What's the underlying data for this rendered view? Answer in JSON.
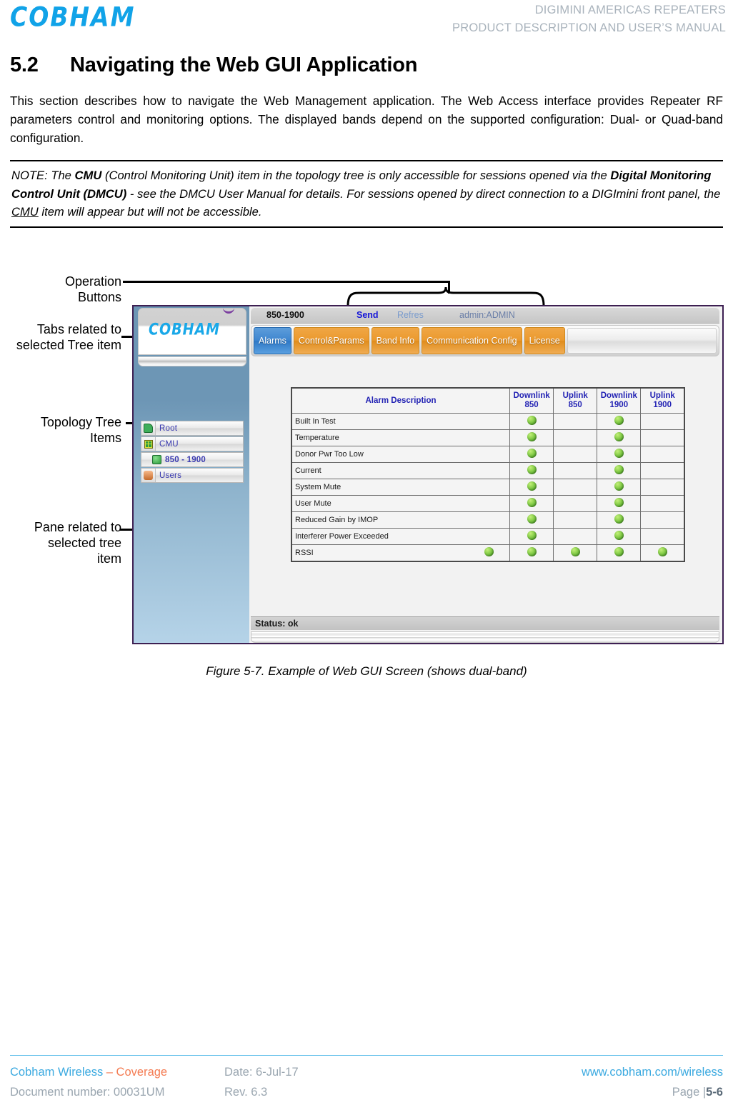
{
  "header": {
    "logo": "COBHAM",
    "line1": "DIGIMINI AMERICAS REPEATERS",
    "line2": "PRODUCT DESCRIPTION AND USER’S MANUAL"
  },
  "section": {
    "number": "5.2",
    "title": "Navigating the Web GUI Application",
    "paragraph": "This section describes how to navigate the Web Management application. The Web Access interface provides Repeater RF parameters control and monitoring options. The displayed bands depend on the supported configuration: Dual- or Quad-band configuration."
  },
  "note": {
    "p1_a": "NOTE: The ",
    "p1_b": "CMU",
    "p1_c": " (Control Monitoring Unit) item in the topology tree is only accessible for sessions opened via the ",
    "p1_d": "Digital Monitoring Control Unit (DMCU)",
    "p1_e": " - see the DMCU User Manual for details. For sessions opened by direct connection to a DIGImini front panel, the ",
    "p1_f": "CMU",
    "p1_g": " item will appear but will not be accessible."
  },
  "callouts": {
    "operation_buttons": "Operation\nButtons",
    "tabs": "Tabs related to\nselected Tree item",
    "topology": "Topology Tree\nItems",
    "pane": "Pane related to\nselected tree\nitem"
  },
  "gui": {
    "logo": "COBHAM",
    "topbar": {
      "band": "850-1900",
      "send": "Send",
      "refresh": "Refres",
      "user": "admin:ADMIN"
    },
    "tabs": [
      {
        "label": "Alarms",
        "active": true
      },
      {
        "label": "Control&Params",
        "active": false
      },
      {
        "label": "Band Info",
        "active": false
      },
      {
        "label": "Communication Config",
        "active": false
      },
      {
        "label": "License",
        "active": false
      }
    ],
    "tree": [
      {
        "label": "Root",
        "icon": "root-node-icon",
        "level": 0
      },
      {
        "label": "CMU",
        "icon": "cmu-node-icon",
        "level": 1
      },
      {
        "label": "850 - 1900",
        "icon": "band-node-icon",
        "level": 2
      },
      {
        "label": "Users",
        "icon": "users-node-icon",
        "level": 0
      }
    ],
    "alarm_table": {
      "columns": [
        "Alarm Description",
        "Downlink 850",
        "Uplink 850",
        "Downlink 1900",
        "Uplink 1900"
      ],
      "column_lines": [
        [
          "Alarm Description",
          ""
        ],
        [
          "Downlink",
          "850"
        ],
        [
          "Uplink",
          "850"
        ],
        [
          "Downlink",
          "1900"
        ],
        [
          "Uplink",
          "1900"
        ]
      ],
      "rows": [
        {
          "name": "Built In Test",
          "leds": [
            false,
            true,
            false,
            true,
            false
          ]
        },
        {
          "name": "Temperature",
          "leds": [
            false,
            true,
            false,
            true,
            false
          ]
        },
        {
          "name": "Donor Pwr Too Low",
          "leds": [
            false,
            true,
            false,
            true,
            false
          ]
        },
        {
          "name": "Current",
          "leds": [
            false,
            true,
            false,
            true,
            false
          ]
        },
        {
          "name": "System Mute",
          "leds": [
            false,
            true,
            false,
            true,
            false
          ]
        },
        {
          "name": "User Mute",
          "leds": [
            false,
            true,
            false,
            true,
            false
          ]
        },
        {
          "name": "Reduced Gain by IMOP",
          "leds": [
            false,
            true,
            false,
            true,
            false
          ]
        },
        {
          "name": "Interferer Power Exceeded",
          "leds": [
            false,
            true,
            false,
            true,
            false
          ]
        },
        {
          "name": "RSSI",
          "leds": [
            true,
            true,
            true,
            true,
            true
          ]
        }
      ]
    },
    "status": "Status: ok"
  },
  "figure_caption": "Figure 5-7. Example of Web GUI Screen (shows dual-band)",
  "footer": {
    "company": "Cobham Wireless ",
    "coverage": "– Coverage",
    "date": "Date: 6-Jul-17",
    "website": "www.cobham.com/wireless",
    "document": "Document number: 00031UM",
    "rev": "Rev. 6.3",
    "page_label": "Page |",
    "page_number": "5-6"
  },
  "colors": {
    "brand_blue": "#11A3E8",
    "accent_orange": "#F0A645",
    "tab_active_blue": "#3F86CF",
    "led_green": "#8ED24F",
    "footer_blue": "#3AA9E0",
    "footer_orange": "#F47B52"
  }
}
